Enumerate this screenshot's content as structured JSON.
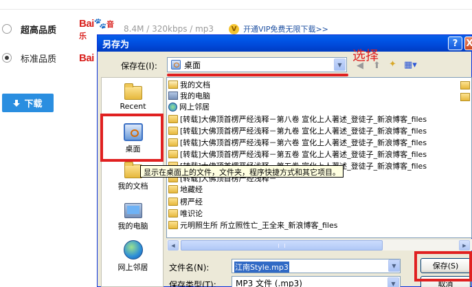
{
  "page": {
    "quality_options": [
      {
        "label": "超高品质",
        "checked": false,
        "bold": true,
        "info": "8.4M / 320kbps / mp3",
        "vip_icon": "V",
        "vip_link": "开通VIP免费无限下载>>"
      },
      {
        "label": "标准品质",
        "checked": true,
        "bold": false
      }
    ],
    "baidu_logo_text": "Bai",
    "baidu_logo_suffix": "音乐",
    "download_button": "下载"
  },
  "dialog": {
    "title": "另存为",
    "help_button": "?",
    "close_button": "X",
    "save_in_label": "保存在(I):",
    "save_in_value": "桌面",
    "annotation_text": "选择",
    "places": [
      {
        "label": "Recent",
        "icon": "recent-folder-icon"
      },
      {
        "label": "桌面",
        "icon": "desktop-icon"
      },
      {
        "label": "我的文档",
        "icon": "my-documents-icon"
      },
      {
        "label": "我的电脑",
        "icon": "my-computer-icon"
      },
      {
        "label": "网上邻居",
        "icon": "network-places-icon"
      }
    ],
    "files": [
      {
        "name": "我的文档",
        "icon": "docs"
      },
      {
        "name": "我的电脑",
        "icon": "pc"
      },
      {
        "name": "网上邻居",
        "icon": "net"
      },
      {
        "name": "[转载]大佛顶首楞严经浅释－第八卷 宣化上人著述_登徒子_新浪博客_files",
        "icon": "folder"
      },
      {
        "name": "[转载]大佛顶首楞严经浅释－第九卷 宣化上人著述_登徒子_新浪博客_files",
        "icon": "folder"
      },
      {
        "name": "[转载]大佛顶首楞严经浅释－第六卷 宣化上人著述_登徒子_新浪博客_files",
        "icon": "folder"
      },
      {
        "name": "[转载]大佛顶首楞严经浅释－第五卷 宣化上人著述_登徒子_新浪博客_files",
        "icon": "folder"
      },
      {
        "name": "[转载]大佛顶首楞严经浅释－第五卷 宣化上人著述_登徒子_新浪博客_files",
        "icon": "folder"
      },
      {
        "name": "[转载]大佛顶首楞严经浅释－",
        "icon": "folder"
      },
      {
        "name": "地藏经",
        "icon": "folder"
      },
      {
        "name": "楞严经",
        "icon": "folder"
      },
      {
        "name": "唯识论",
        "icon": "folder"
      },
      {
        "name": "元明照生所 所立照性亡_王全来_新浪博客_files",
        "icon": "folder"
      }
    ],
    "tooltip": "显示在桌面上的文件，文件夹，程序快捷方式和其它项目。",
    "filename_label": "文件名(N):",
    "filename_value": "江南Style.mp3",
    "filetype_label": "保存类型(T):",
    "filetype_value": "MP3 文件 (.mp3)",
    "save_button": "保存(S)",
    "cancel_button": "取消"
  },
  "colors": {
    "annotation_red": "#e02020",
    "xp_title_blue": "#0055e6",
    "download_blue": "#2a8ee0"
  }
}
